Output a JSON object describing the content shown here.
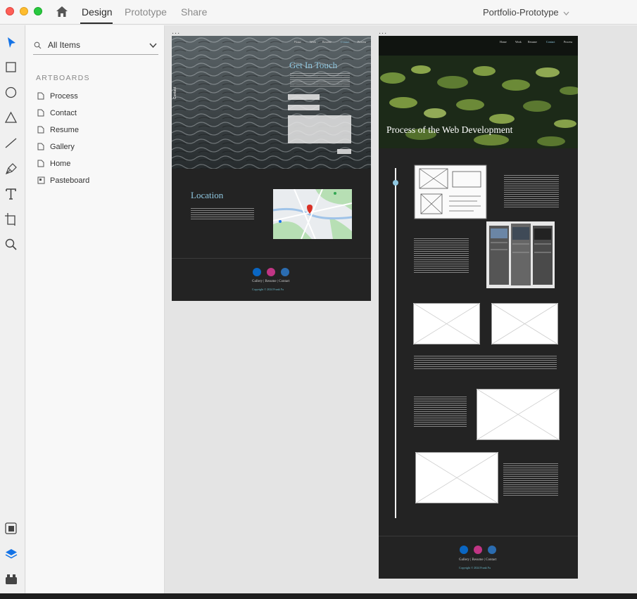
{
  "window": {
    "tabs": [
      "Design",
      "Prototype",
      "Share"
    ],
    "active_tab": "Design",
    "document_title": "Portfolio-Prototype"
  },
  "layers_panel": {
    "filter_label": "All Items",
    "section_title": "ARTBOARDS",
    "artboards": [
      "Process",
      "Contact",
      "Resume",
      "Gallery",
      "Home",
      "Pasteboard"
    ]
  },
  "toolbar": {
    "tools": [
      "select-tool",
      "rectangle-tool",
      "ellipse-tool",
      "polygon-tool",
      "line-tool",
      "pen-tool",
      "text-tool",
      "artboard-tool",
      "zoom-tool"
    ],
    "bottom_tools": [
      "plugins-icon",
      "layers-icon",
      "assets-icon"
    ]
  },
  "canvas": {
    "artboard_more": "...",
    "contact_board": {
      "nav": [
        "Home",
        "Work",
        "Resume",
        "Contact",
        "Process"
      ],
      "side_label": "Contact",
      "hero_title": "Get In Touch",
      "location_title": "Location",
      "footer_links": "Gallery | Resume | Contact",
      "copyright": "Copyright © 2024 Frank Fu"
    },
    "process_board": {
      "nav": [
        "Home",
        "Work",
        "Resume",
        "Contact",
        "Process"
      ],
      "hero_title": "Process of the Web Development",
      "footer_links": "Gallery | Resume | Contact",
      "copyright": "Copyright © 2024 Frank Fu"
    }
  },
  "colors": {
    "accent_blue": "#1473e6",
    "board_bg": "#232323",
    "title_blue": "#8fc7e0",
    "linkedin": "#0a66c2",
    "instagram": "#c13584",
    "github": "#2b6cb0"
  }
}
